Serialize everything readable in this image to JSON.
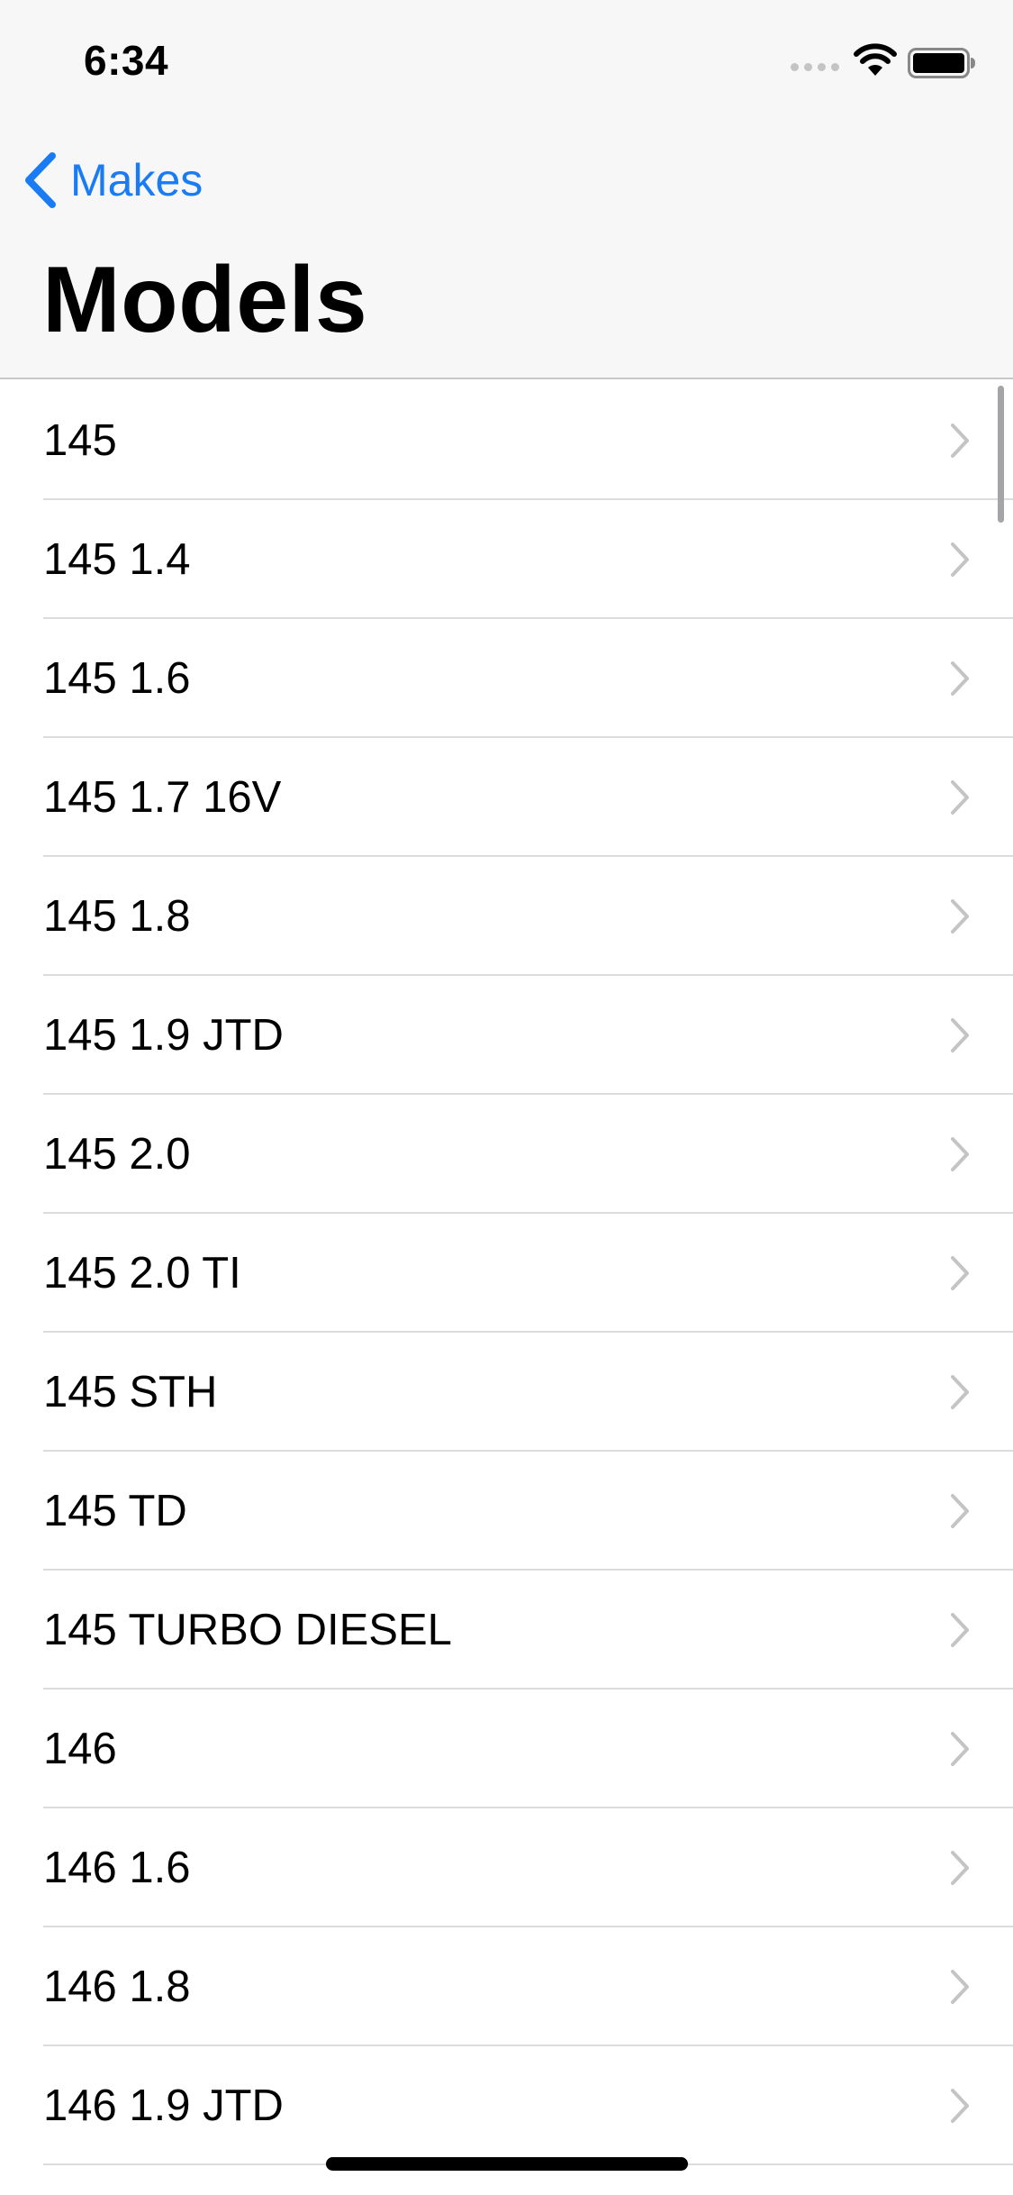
{
  "status_bar": {
    "time": "6:34",
    "signal_icon": "cellular-signal-icon",
    "wifi_icon": "wifi-icon",
    "battery_icon": "battery-full-icon"
  },
  "nav": {
    "back_label": "Makes",
    "back_icon": "chevron-left-icon",
    "title": "Models",
    "accent_color": "#1a7cf4"
  },
  "models": [
    "145",
    "145 1.4",
    "145 1.6",
    "145 1.7 16V",
    "145 1.8",
    "145 1.9 JTD",
    "145 2.0",
    "145 2.0 TI",
    "145 STH",
    "145 TD",
    "145 TURBO DIESEL",
    "146",
    "146 1.6",
    "146 1.8",
    "146 1.9 JTD"
  ],
  "row_icon": "chevron-right-icon"
}
